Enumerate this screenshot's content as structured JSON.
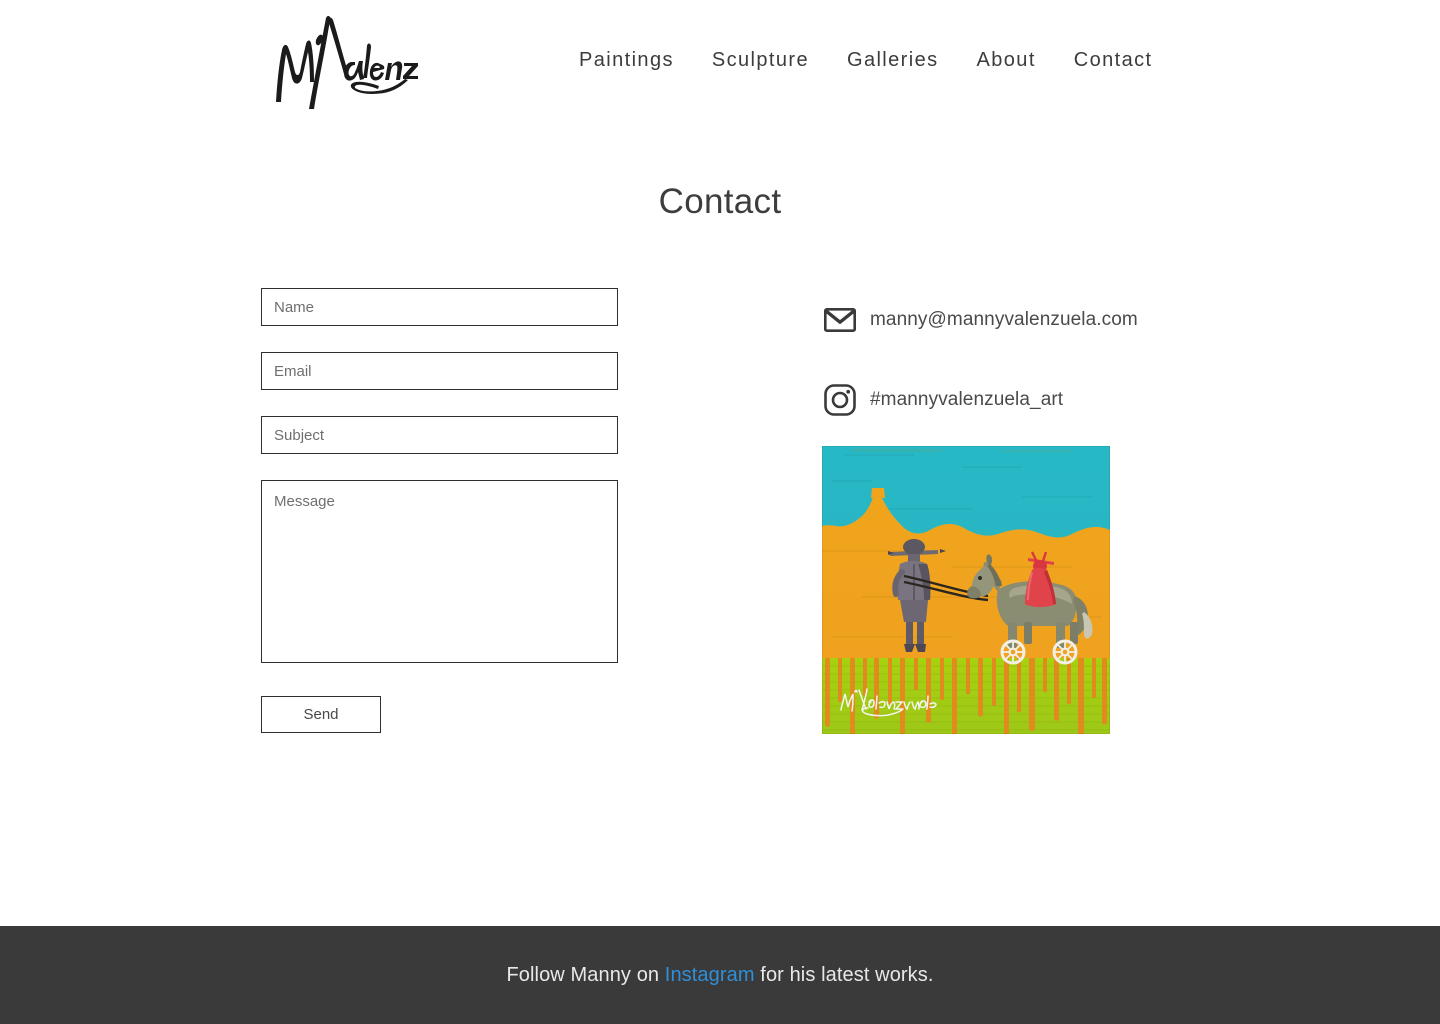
{
  "header": {
    "logo_alt": "M Valenzuela signature logo",
    "nav": [
      {
        "label": "Paintings",
        "name": "nav-link-paintings"
      },
      {
        "label": "Sculpture",
        "name": "nav-link-sculpture"
      },
      {
        "label": "Galleries",
        "name": "nav-link-galleries"
      },
      {
        "label": "About",
        "name": "nav-link-about"
      },
      {
        "label": "Contact",
        "name": "nav-link-contact"
      }
    ]
  },
  "main": {
    "title": "Contact",
    "form": {
      "name_placeholder": "Name",
      "name_value": "",
      "email_placeholder": "Email",
      "email_value": "",
      "subject_placeholder": "Subject",
      "subject_value": "",
      "message_placeholder": "Message",
      "message_value": "",
      "send_label": "Send"
    },
    "contact_info": {
      "email_icon": "envelope-icon",
      "email": "manny@mannyvalenzuela.com",
      "instagram_icon": "instagram-icon",
      "instagram_handle": "#mannyvalenzuela_art"
    },
    "artwork": {
      "caption": "Painting of a figure leading a wheeled horse with a red-robed rider across an orange desert under a teal sky",
      "signature": "Valenzuela",
      "colors": {
        "sky": "#29b5c3",
        "desert": "#eea01c",
        "grass": "#a6cf14",
        "drip": "#e08a22",
        "rider": "#e0434a",
        "horse": "#8a8f73"
      }
    }
  },
  "footer": {
    "text_before": "Follow Manny on ",
    "link_label": "Instagram",
    "text_after": " for his latest works.",
    "link_color": "#2f8fd8",
    "background": "#3a3a3a"
  }
}
